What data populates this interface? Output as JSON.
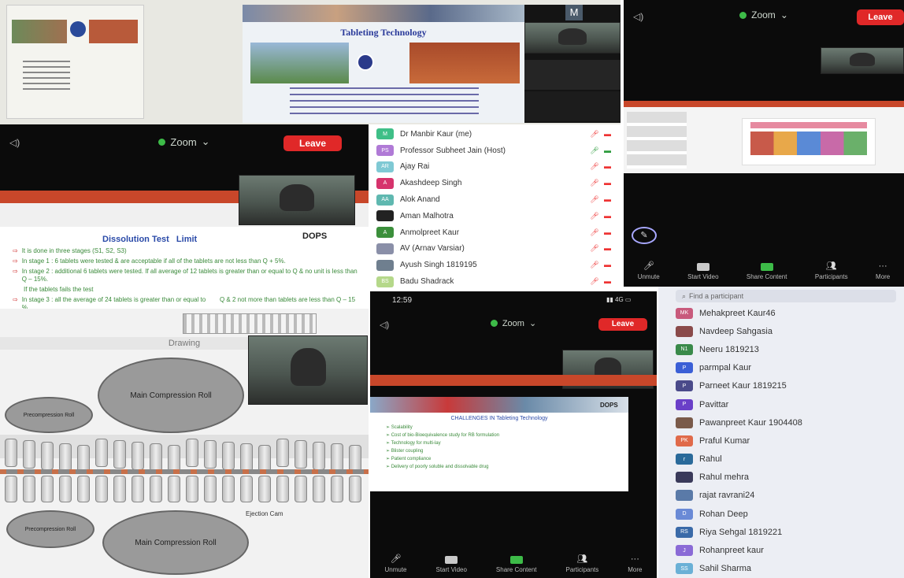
{
  "zoom": {
    "app_name": "Zoom",
    "leave_label": "Leave",
    "signal_text": "4G",
    "phone_time": "12:59"
  },
  "tl_slide": {
    "title": "Tableting Technology",
    "avatar_letter": "M"
  },
  "dissolution_slide": {
    "title": "Dissolution Test   Limit",
    "logo": "DOPS",
    "bullets": [
      "It is done in three stages (S1, S2, S3)",
      "In stage 1 : 6 tablets were tested & are acceptable if all of the tablets are not less than Q + 5%.",
      "In stage 2 : additional 6 tablets were tested. If all average of 12 tablets is greater than or equal to Q & no unit is less than Q – 15%.",
      "If the tablets fails the test",
      "In stage 3 : all the average of 24 tablets is greater than or equal to        Q & 2 not more than tablets are less than Q – 15 %."
    ]
  },
  "drawing": {
    "label": "Drawing",
    "roller_main_top": "Main Compression Roll",
    "roller_pre_top": "Precompression Roll",
    "roller_main_bottom": "Main Compression Roll",
    "roller_pre_bottom": "Precompression Roll",
    "ejection": "Ejection Cam"
  },
  "br_slide": {
    "logo": "DOPS",
    "title": "CHALLENGES IN Tableting Technology",
    "items": [
      "Scalability",
      "Cost of bio-Bioequivalence study for RB formulation",
      "Technology for multi-lay",
      "Blister coupling",
      "Patient compliance",
      "Delivery of poorly soluble and dissolvable drug"
    ]
  },
  "participants_mid": [
    {
      "initials": "M",
      "name": "Dr Manbir Kaur (me)",
      "color": "#3fbf87"
    },
    {
      "initials": "PS",
      "name": "Professor Subheet Jain (Host)",
      "color": "#b07ad6"
    },
    {
      "initials": "AR",
      "name": "Ajay Rai",
      "color": "#7fc9d4"
    },
    {
      "initials": "A",
      "name": "Akashdeep Singh",
      "color": "#d6336c"
    },
    {
      "initials": "AA",
      "name": "Alok Anand",
      "color": "#5fb8b0"
    },
    {
      "initials": "",
      "name": "Aman Malhotra",
      "color": "#222222"
    },
    {
      "initials": "A",
      "name": "Anmolpreet Kaur",
      "color": "#3b8f3b"
    },
    {
      "initials": "",
      "name": "AV (Arnav Varsiar)",
      "color": "#8a8fa8"
    },
    {
      "initials": "",
      "name": "Ayush Singh 1819195",
      "color": "#6f7f8f"
    },
    {
      "initials": "BS",
      "name": "Badu Shadrack",
      "color": "#b5d88a"
    }
  ],
  "participants_right": {
    "search_placeholder": "Find a participant",
    "items": [
      {
        "initials": "MK",
        "name": "Mehakpreet Kaur46",
        "color": "#c85a7c"
      },
      {
        "initials": "",
        "name": "Navdeep Sahgasia",
        "color": "#8a4a4a"
      },
      {
        "initials": "N1",
        "name": "Neeru 1819213",
        "color": "#3a8a4a"
      },
      {
        "initials": "P",
        "name": "parmpal Kaur",
        "color": "#3b5fd6"
      },
      {
        "initials": "P",
        "name": "Parneet Kaur 1819215",
        "color": "#4a4a8a"
      },
      {
        "initials": "P",
        "name": "Pavittar",
        "color": "#6a3fc8"
      },
      {
        "initials": "",
        "name": "Pawanpreet Kaur 1904408",
        "color": "#7a5a4a"
      },
      {
        "initials": "PK",
        "name": "Praful Kumar",
        "color": "#e06a4a"
      },
      {
        "initials": "r",
        "name": "Rahul",
        "color": "#2a6a9a"
      },
      {
        "initials": "",
        "name": "Rahul mehra",
        "color": "#3a3a5a"
      },
      {
        "initials": "",
        "name": "rajat ravrani24",
        "color": "#5a7aa8"
      },
      {
        "initials": "D",
        "name": "Rohan Deep",
        "color": "#6a8ad6"
      },
      {
        "initials": "RS",
        "name": "Riya Sehgal 1819221",
        "color": "#3a6aa8"
      },
      {
        "initials": "J",
        "name": "Rohanpreet kaur",
        "color": "#8a6ad6"
      },
      {
        "initials": "SS",
        "name": "Sahil Sharma",
        "color": "#6ab0d6"
      }
    ]
  },
  "toolbar_tr": [
    "Unmute",
    "Start Video",
    "Share Content",
    "Participants",
    "More"
  ],
  "toolbar_br": [
    "Unmute",
    "Start Video",
    "Share Content",
    "Participants",
    "More"
  ]
}
